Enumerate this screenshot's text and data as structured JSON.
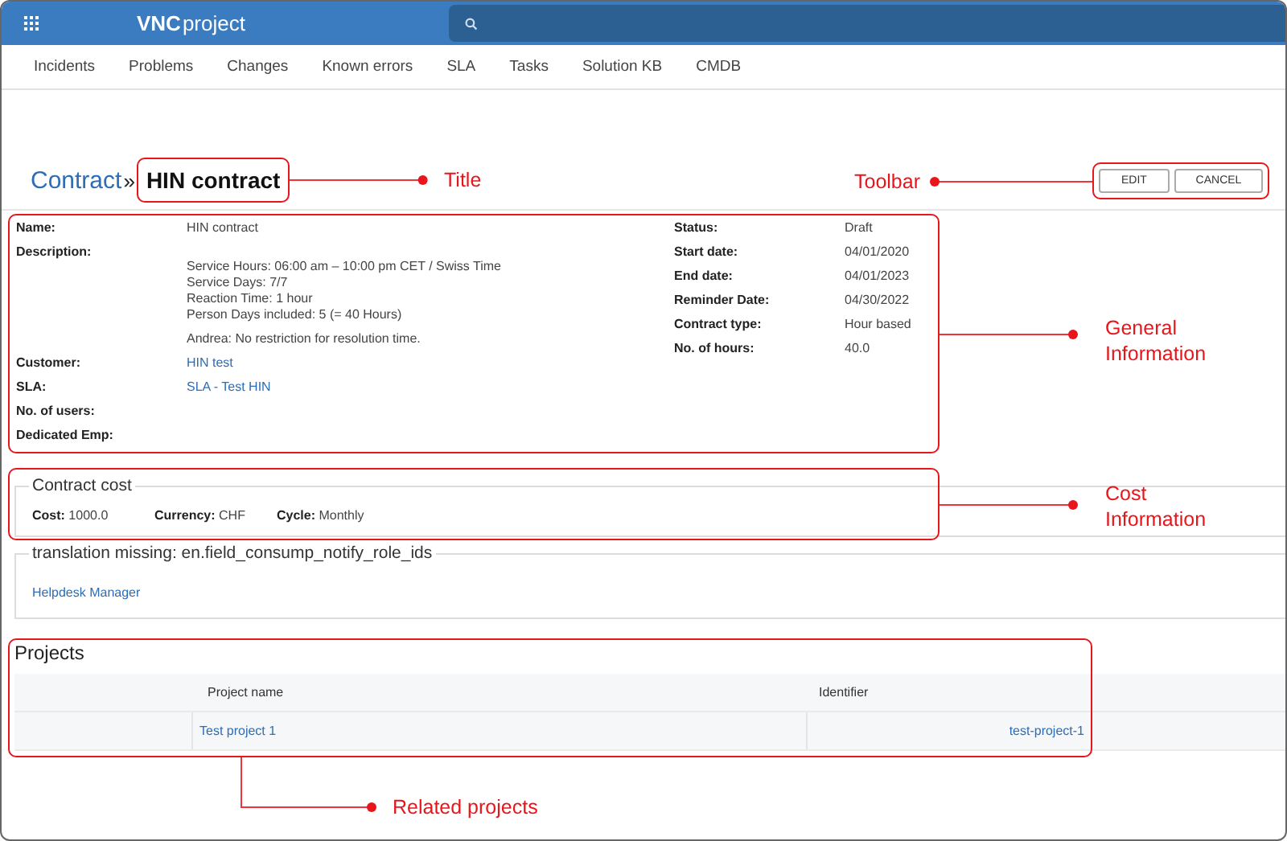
{
  "app": {
    "logo_bold": "VNC",
    "logo_rest": "project"
  },
  "nav": [
    {
      "label": "Incidents"
    },
    {
      "label": "Problems"
    },
    {
      "label": "Changes"
    },
    {
      "label": "Known errors"
    },
    {
      "label": "SLA"
    },
    {
      "label": "Tasks"
    },
    {
      "label": "Solution KB"
    },
    {
      "label": "CMDB"
    }
  ],
  "breadcrumb": {
    "parent": "Contract",
    "separator": "»",
    "title": "HIN contract"
  },
  "toolbar": [
    {
      "label": "EDIT"
    },
    {
      "label": "CANCEL"
    }
  ],
  "general": {
    "left": [
      {
        "label": "Name:",
        "lines": [
          "HIN contract"
        ],
        "kind": "text"
      },
      {
        "label": "Description:",
        "lines": [
          "Service Hours: 06:00 am – 10:00 pm CET / Swiss Time",
          "Service Days: 7/7",
          "Reaction Time: 1 hour",
          "Person Days included: 5 (= 40 Hours)",
          "Andrea: No restriction for resolution time."
        ],
        "kind": "description"
      },
      {
        "label": "Customer:",
        "lines": [
          "HIN test"
        ],
        "kind": "link"
      },
      {
        "label": "SLA:",
        "lines": [
          "SLA - Test HIN"
        ],
        "kind": "link"
      },
      {
        "label": "No. of users:",
        "kind": "text"
      },
      {
        "label": "Dedicated Emp:",
        "kind": "text"
      }
    ],
    "right": [
      {
        "label": "Status:",
        "value": "Draft"
      },
      {
        "label": "Start date:",
        "value": "04/01/2020"
      },
      {
        "label": "End date:",
        "value": "04/01/2023"
      },
      {
        "label": "Reminder Date:",
        "value": "04/30/2022"
      },
      {
        "label": "Contract type:",
        "value": "Hour based"
      },
      {
        "label": "No. of hours:",
        "value": "40.0"
      }
    ]
  },
  "contract_cost": {
    "legend": "Contract cost",
    "fields": [
      {
        "label": "Cost:",
        "value": "1000.0"
      },
      {
        "label": "Currency:",
        "value": "CHF"
      },
      {
        "label": "Cycle:",
        "value": "Monthly"
      }
    ]
  },
  "notify": {
    "legend": "translation missing: en.field_consump_notify_role_ids",
    "links": [
      "Helpdesk Manager"
    ]
  },
  "projects": {
    "title": "Projects",
    "columns": [
      "Project name",
      "Identifier"
    ],
    "rows": [
      {
        "name": "Test project 1",
        "identifier": "test-project-1"
      }
    ]
  },
  "annotations": [
    {
      "label": "Title"
    },
    {
      "label": "Toolbar"
    },
    {
      "label": "General Information"
    },
    {
      "label": "Cost Information"
    },
    {
      "label": "Related projects"
    }
  ]
}
